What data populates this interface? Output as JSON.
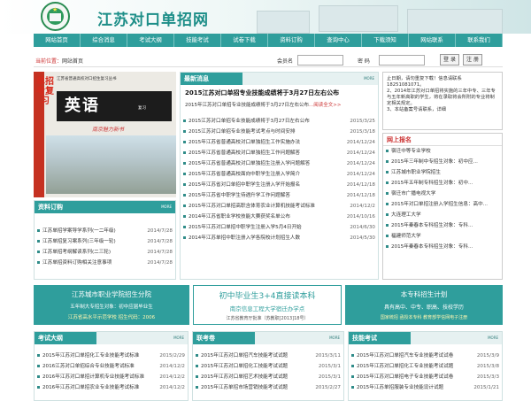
{
  "site": {
    "title": "江苏对口单招网"
  },
  "nav": [
    "网站首页",
    "综合消息",
    "考试大纲",
    "技能考试",
    "试卷下载",
    "资料订购",
    "查询中心",
    "下载须知",
    "网站联系",
    "联系我们"
  ],
  "subbar": {
    "location_label": "当前位置：",
    "location": "网站首页",
    "user_label": "会员名",
    "pwd_label": "密 码",
    "login": "登 录",
    "register": "注 册"
  },
  "book": {
    "vtitle": "单招考复习",
    "header": "江苏省普通高校对口招生复习丛书",
    "subject": "英语",
    "sub2": "复习",
    "brand": "南京魅力新书"
  },
  "notice": [
    "止日期，请勿重复下载！信息请联系18251081071。",
    "2、2014年江苏对口单招将实施的三年中专、三年专与五年新高职的学生，将在录取将会所附的专业将制定相关规定。",
    "3、本站备案号请联系，详细"
  ],
  "latest": {
    "title": "最新消息",
    "more": "MORE",
    "headline": "2015江苏对口单招专业技能成绩将于3月27日左右公布",
    "sub": "2015年江苏对口单招专业技能成绩将于3月27日左右公布",
    "read": "...阅读全文>>",
    "items": [
      {
        "t": "2015江苏对口单招专业技能成绩将于3月27日左右公布",
        "d": "2015/3/25"
      },
      {
        "t": "2015江苏对口单招专业技能考试考点与时间安排",
        "d": "2015/3/18"
      },
      {
        "t": "2015年江苏省普通高校对口单独招生工作实施办法",
        "d": "2014/12/24"
      },
      {
        "t": "2015年江苏省普通高校对口单独招生工作问题解答",
        "d": "2014/12/24"
      },
      {
        "t": "2015年江苏省普通高校对口单独招生注册入学问题解答",
        "d": "2014/12/24"
      },
      {
        "t": "2015年江苏省普通高校面向中职学生注册入学简介",
        "d": "2014/12/24"
      },
      {
        "t": "2015年江苏省对口单招中职学生注册入学开始报名",
        "d": "2014/12/18"
      },
      {
        "t": "2015年江苏省中职学生待遇升学工作问题解答",
        "d": "2014/12/18"
      },
      {
        "t": "2015年江苏对口单招高职含体育农业计算机技能考试标准",
        "d": "2014/12/2"
      },
      {
        "t": "2014年江苏省职业学校技能大赛获奖名单公布",
        "d": "2014/10/16"
      },
      {
        "t": "2015年江苏对口单招中职学生注册入学5月4日开始",
        "d": "2014/6/30"
      },
      {
        "t": "2014年江苏单招中职注册入学各院校计划招生人数",
        "d": "2014/5/30"
      }
    ]
  },
  "reg": {
    "title": "网上报名",
    "items": [
      "宿迁中等专业学校",
      "2015年三年制中专招生对象：初中应...",
      "江苏城市职业学院招生",
      "2015年五年制专科招生对象：初中...",
      "宿迁市广播电视大学",
      "2015年对口单招注册入学招生信息：高中...",
      "大连理工大学",
      "2015年秦春本专科招生对象：专科...",
      "福建师范大学",
      "2015年秦春本专科招生对象：专科..."
    ]
  },
  "order": {
    "title": "资料订购",
    "more": "MORE",
    "items": [
      {
        "t": "江苏单招学案导学系列(一二年级)",
        "d": "2014/7/28"
      },
      {
        "t": "江苏单招复习案系列(三年级一轮)",
        "d": "2014/7/28"
      },
      {
        "t": "江苏单招考纲解读系列(二三轮)",
        "d": "2014/7/28"
      },
      {
        "t": "江苏单招资料订购相关注意事项",
        "d": "2014/7/28"
      }
    ]
  },
  "banners": [
    {
      "l1": "江苏城市职业学院招生分院",
      "l2": "五年制大专招生对象：初中应届毕业生",
      "l3": "江苏省高水平示范学校 招生代码：2006"
    },
    {
      "l1": "初中毕业生3+4直接读本科",
      "l2": "南京信息工程大学宿迁办学点",
      "l3": "江苏省教育厅批准（苏教职[2013]18号）"
    },
    {
      "l1": "本专科招生计划",
      "l2": "具有高中、中专、职高、技校学历",
      "l3": "国家统招 函授本专科 教育部学信网电子注册"
    }
  ],
  "exam": {
    "title": "考试大纲",
    "more": "MORE",
    "items": [
      {
        "t": "2015年江苏对口单招化工专业技能考试标准",
        "d": "2015/2/29"
      },
      {
        "t": "2016江苏对口单招综合专业技能考试标准",
        "d": "2014/12/2"
      },
      {
        "t": "2016年江苏对口单招计算机专业技能考试标准",
        "d": "2014/12/2"
      },
      {
        "t": "2016年江苏对口单招农业专业技能考试标准",
        "d": "2014/12/2"
      }
    ]
  },
  "annual": {
    "title": "联考卷",
    "more": "MORE",
    "items": [
      {
        "t": "2015年江苏对口单招汽车技能考试试题",
        "d": "2015/3/11"
      },
      {
        "t": "2015年江苏对口单招化工技能考试试题",
        "d": "2015/3/1"
      },
      {
        "t": "2015年江苏对口单招艺术技能考试试题",
        "d": "2015/3/1"
      },
      {
        "t": "2015年江苏单招市场营销技能考试试题",
        "d": "2015/2/27"
      }
    ]
  },
  "skill": {
    "title": "技能考试",
    "more": "MORE",
    "items": [
      {
        "t": "2015年江苏对口单招汽车专业技能考试试卷",
        "d": "2015/3/9"
      },
      {
        "t": "2015年江苏对口单招化工专业技能考试试题",
        "d": "2015/3/8"
      },
      {
        "t": "2015年江苏对口单招电子专业技能考试试卷",
        "d": "2015/3/3"
      },
      {
        "t": "2015年江苏单招服装专业技能设计试题",
        "d": "2015/1/21"
      }
    ]
  }
}
